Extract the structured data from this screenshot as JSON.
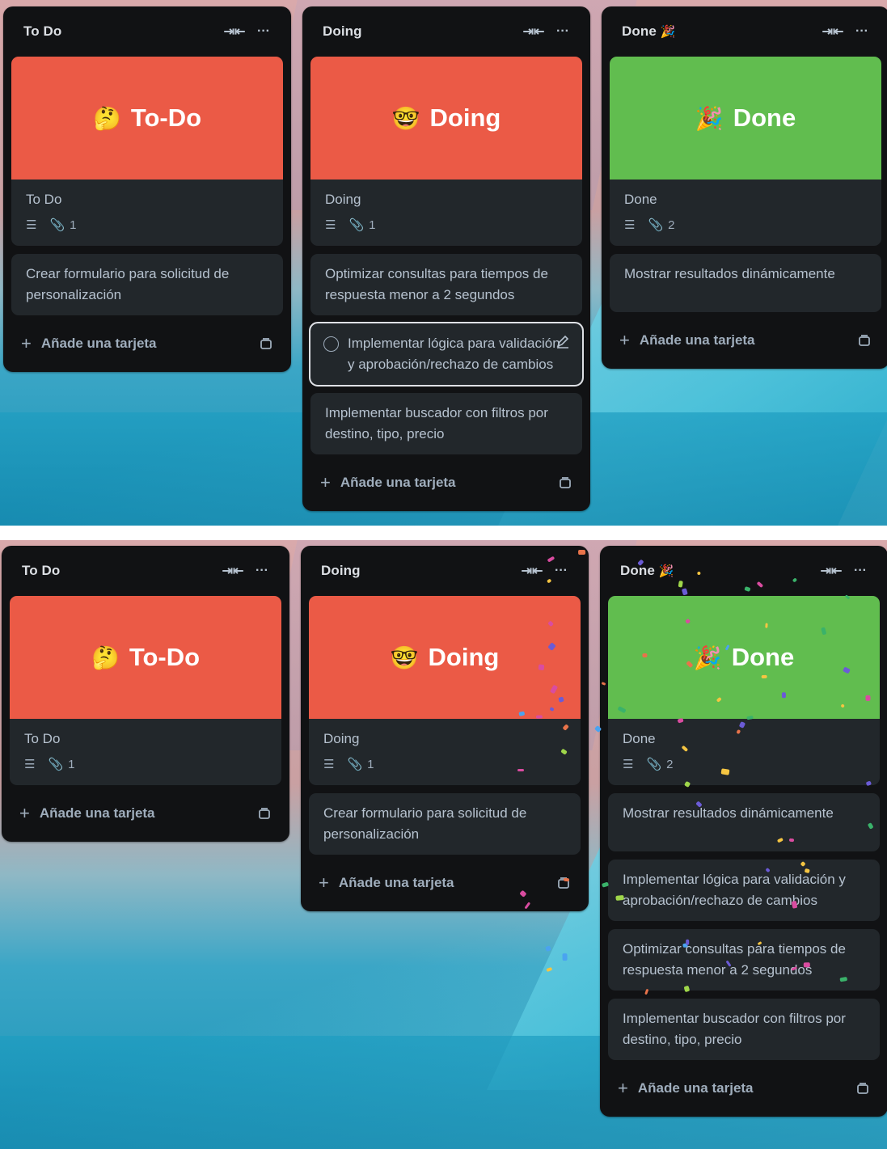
{
  "colors": {
    "red_cover": "#eb5a46",
    "green_cover": "#61bd4f",
    "list_bg": "#111214",
    "card_bg": "#22272b",
    "text": "#b6c2cf"
  },
  "icons": {
    "collapse": "collapse-arrows-icon",
    "more": "more-dots-icon",
    "description": "description-lines-icon",
    "attachment": "paperclip-icon",
    "plus": "plus-icon",
    "template": "card-template-icon",
    "edit": "pencil-edit-icon",
    "complete": "circle-checkbox-icon"
  },
  "add_card_label": "Añade una tarjeta",
  "top": {
    "lists": [
      {
        "title": "To Do",
        "cover": {
          "emoji": "🤔",
          "text": "To-Do",
          "color": "#eb5a46"
        },
        "cover_card": {
          "title": "To Do",
          "attachments": "1"
        },
        "cards": [
          {
            "title": "Crear formulario para solicitud de personalización"
          }
        ]
      },
      {
        "title": "Doing",
        "cover": {
          "emoji": "🤓",
          "text": "Doing",
          "color": "#eb5a46"
        },
        "cover_card": {
          "title": "Doing",
          "attachments": "1"
        },
        "cards": [
          {
            "title": "Optimizar consultas para tiempos de respuesta menor a 2 segundos"
          },
          {
            "title": "Implementar lógica para validación y aprobación/rechazo de cambios",
            "hovered": true
          },
          {
            "title": "Implementar buscador con filtros por destino, tipo, precio"
          }
        ]
      },
      {
        "title": "Done",
        "title_emoji": "🎉",
        "cover": {
          "emoji": "🎉",
          "text": "Done",
          "color": "#61bd4f"
        },
        "cover_card": {
          "title": "Done",
          "attachments": "2"
        },
        "cards": [
          {
            "title": "Mostrar resultados dinámicamente"
          }
        ]
      }
    ]
  },
  "bottom": {
    "lists": [
      {
        "title": "To Do",
        "cover": {
          "emoji": "🤔",
          "text": "To-Do",
          "color": "#eb5a46"
        },
        "cover_card": {
          "title": "To Do",
          "attachments": "1"
        },
        "cards": []
      },
      {
        "title": "Doing",
        "cover": {
          "emoji": "🤓",
          "text": "Doing",
          "color": "#eb5a46"
        },
        "cover_card": {
          "title": "Doing",
          "attachments": "1"
        },
        "cards": [
          {
            "title": "Crear formulario para solicitud de personalización"
          }
        ]
      },
      {
        "title": "Done",
        "title_emoji": "🎉",
        "cover": {
          "emoji": "🎉",
          "text": "Done",
          "color": "#61bd4f"
        },
        "cover_card": {
          "title": "Done",
          "attachments": "2"
        },
        "cards": [
          {
            "title": "Mostrar resultados dinámicamente"
          },
          {
            "title": "Implementar lógica para validación y aprobación/rechazo de cambios"
          },
          {
            "title": "Optimizar consultas para tiempos de respuesta menor a 2 segundos"
          },
          {
            "title": "Implementar buscador con filtros por destino, tipo, precio"
          }
        ]
      }
    ]
  }
}
